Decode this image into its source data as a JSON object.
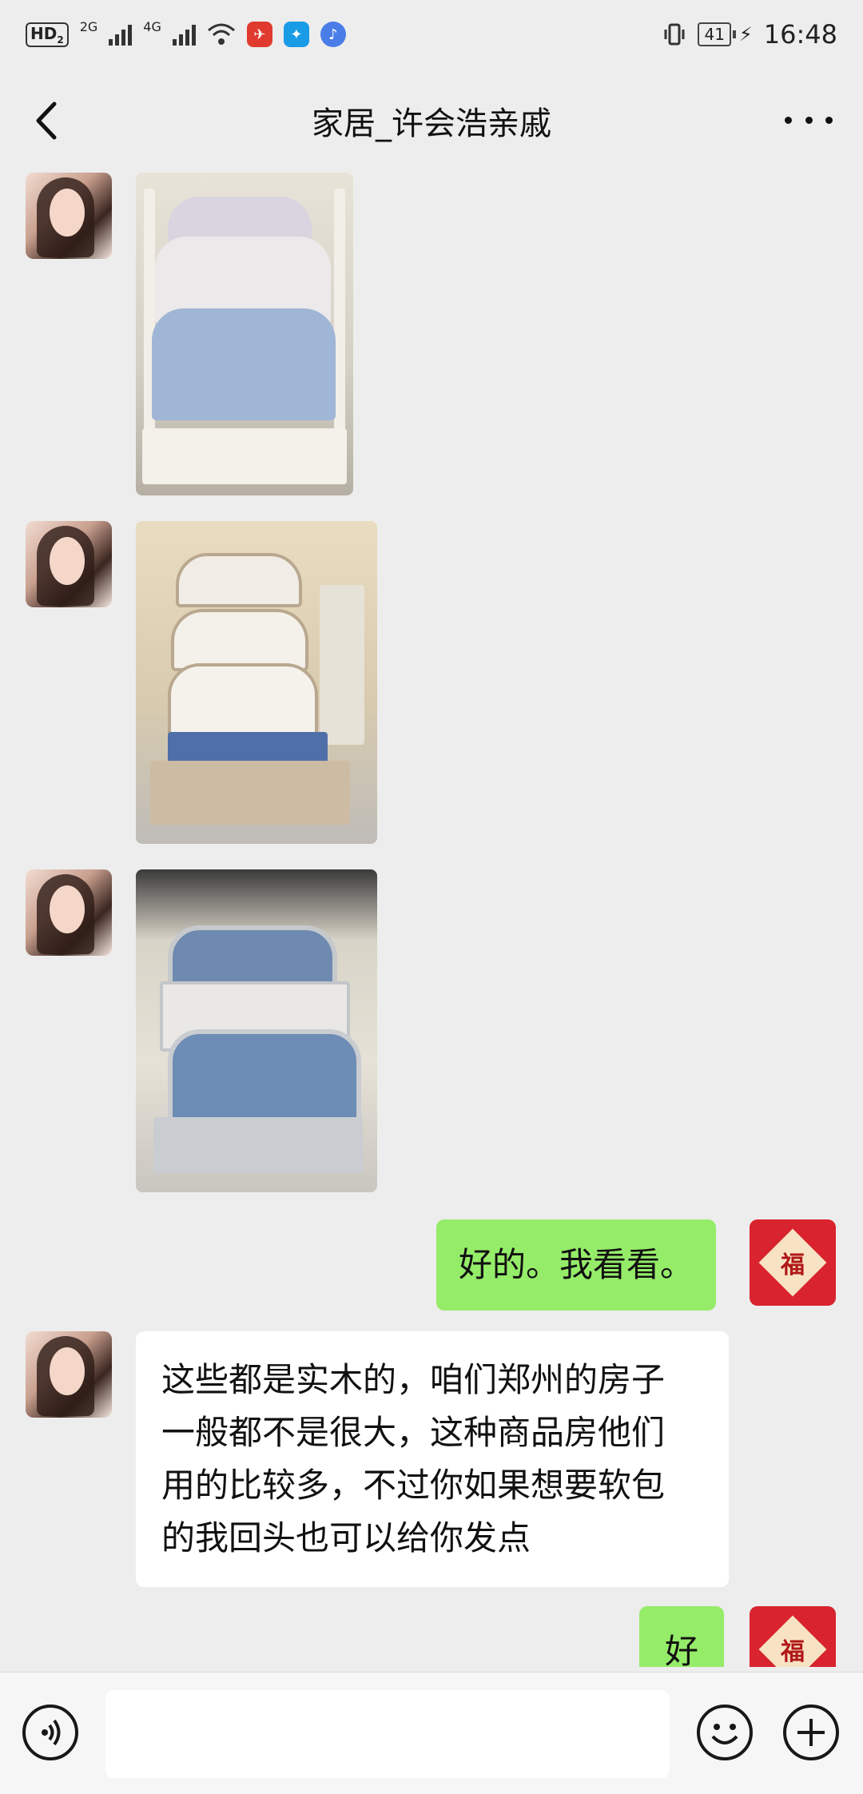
{
  "status_bar": {
    "hd_label": "HD",
    "hd_sub": "2",
    "net1": "2G",
    "net2": "4G",
    "battery": "41",
    "time": "16:48"
  },
  "header": {
    "title": "家居_许会浩亲戚"
  },
  "messages": [
    {
      "sender": "other",
      "type": "image",
      "icon": "bed-photo"
    },
    {
      "sender": "other",
      "type": "image",
      "icon": "bed-photo"
    },
    {
      "sender": "other",
      "type": "image",
      "icon": "bed-photo"
    },
    {
      "sender": "me",
      "type": "text",
      "text": "好的。我看看。"
    },
    {
      "sender": "other",
      "type": "text",
      "lines": [
        "这些都是实木的，咱们郑州的房子",
        "一般都不是很大，这种商品房他们",
        "用的比较多，不过你如果想要软包",
        "的我回头也可以给你发点"
      ]
    },
    {
      "sender": "me",
      "type": "text",
      "text": "好"
    }
  ],
  "avatars": {
    "me_glyph": "福"
  },
  "input_bar": {
    "placeholder": ""
  },
  "colors": {
    "background": "#ededed",
    "my_bubble": "#95ec69",
    "their_bubble": "#ffffff",
    "my_avatar": "#d9232e"
  }
}
